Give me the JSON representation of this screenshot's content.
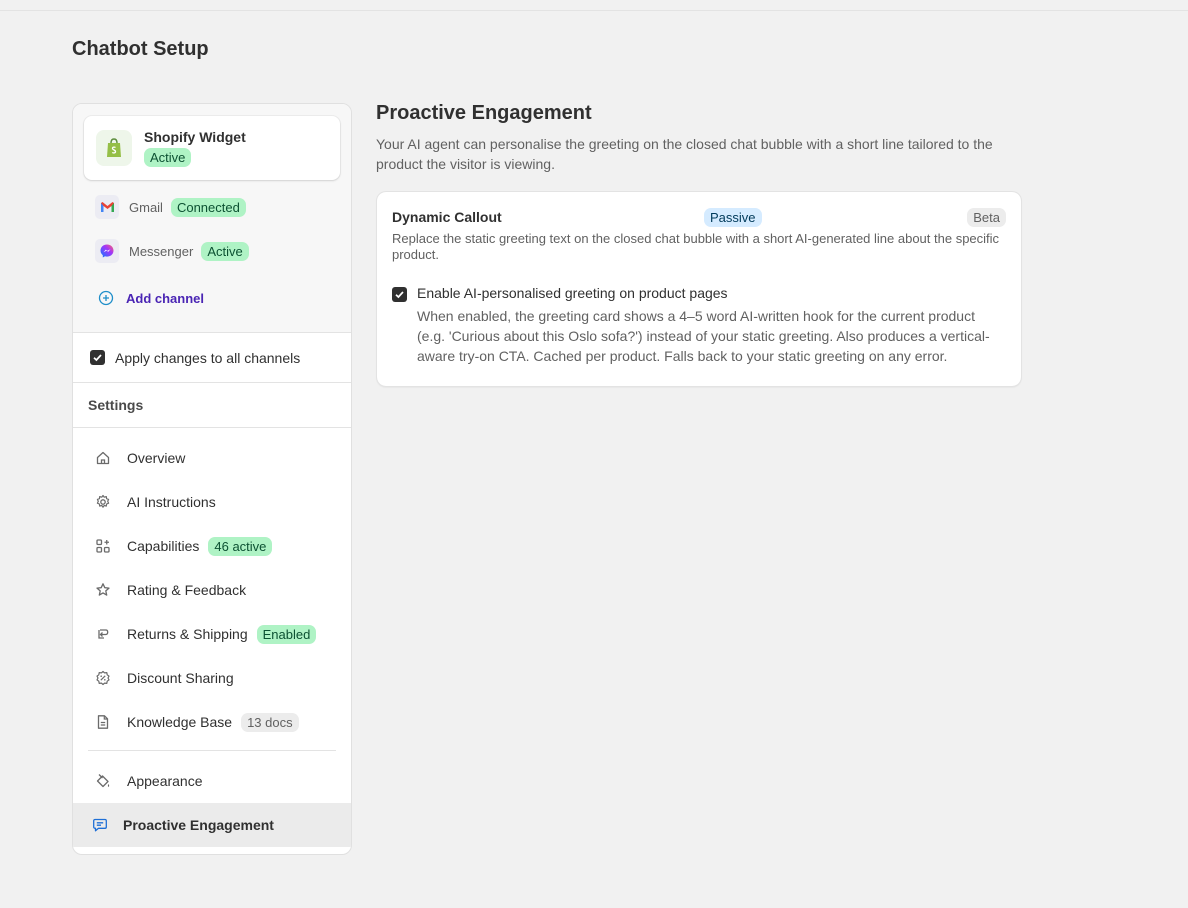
{
  "page": {
    "title": "Chatbot Setup"
  },
  "channels": {
    "primary": {
      "name": "Shopify Widget",
      "status": "Active"
    },
    "items": [
      {
        "name": "Gmail",
        "status": "Connected"
      },
      {
        "name": "Messenger",
        "status": "Active"
      }
    ],
    "add_label": "Add channel"
  },
  "apply_all": {
    "label": "Apply changes to all channels",
    "checked": true
  },
  "settings": {
    "heading": "Settings",
    "items": [
      {
        "label": "Overview",
        "icon": "home-icon"
      },
      {
        "label": "AI Instructions",
        "icon": "gear-icon"
      },
      {
        "label": "Capabilities",
        "icon": "apps-icon",
        "badge": "46 active"
      },
      {
        "label": "Rating & Feedback",
        "icon": "star-icon"
      },
      {
        "label": "Returns & Shipping",
        "icon": "return-icon",
        "badge": "Enabled"
      },
      {
        "label": "Discount Sharing",
        "icon": "discount-icon"
      },
      {
        "label": "Knowledge Base",
        "icon": "document-icon",
        "badge": "13 docs"
      },
      {
        "label": "Appearance",
        "icon": "paint-icon"
      },
      {
        "label": "Proactive Engagement",
        "icon": "chat-icon",
        "active": true
      }
    ]
  },
  "main": {
    "title": "Proactive Engagement",
    "description": "Your AI agent can personalise the greeting on the closed chat bubble with a short line tailored to the product the visitor is viewing.",
    "card": {
      "title": "Dynamic Callout",
      "mode_badge": "Passive",
      "stage_badge": "Beta",
      "description": "Replace the static greeting text on the closed chat bubble with a short AI-generated line about the specific product.",
      "option": {
        "label": "Enable AI-personalised greeting on product pages",
        "checked": true,
        "description": "When enabled, the greeting card shows a 4–5 word AI-written hook for the current product (e.g. 'Curious about this Oslo sofa?') instead of your static greeting. Also produces a vertical-aware try-on CTA. Cached per product. Falls back to your static greeting on any error."
      }
    }
  },
  "colors": {
    "badge_green": "#aff3c5",
    "badge_blue": "#d5ebff",
    "badge_grey": "#ececec",
    "accent": "#4a25b4"
  }
}
